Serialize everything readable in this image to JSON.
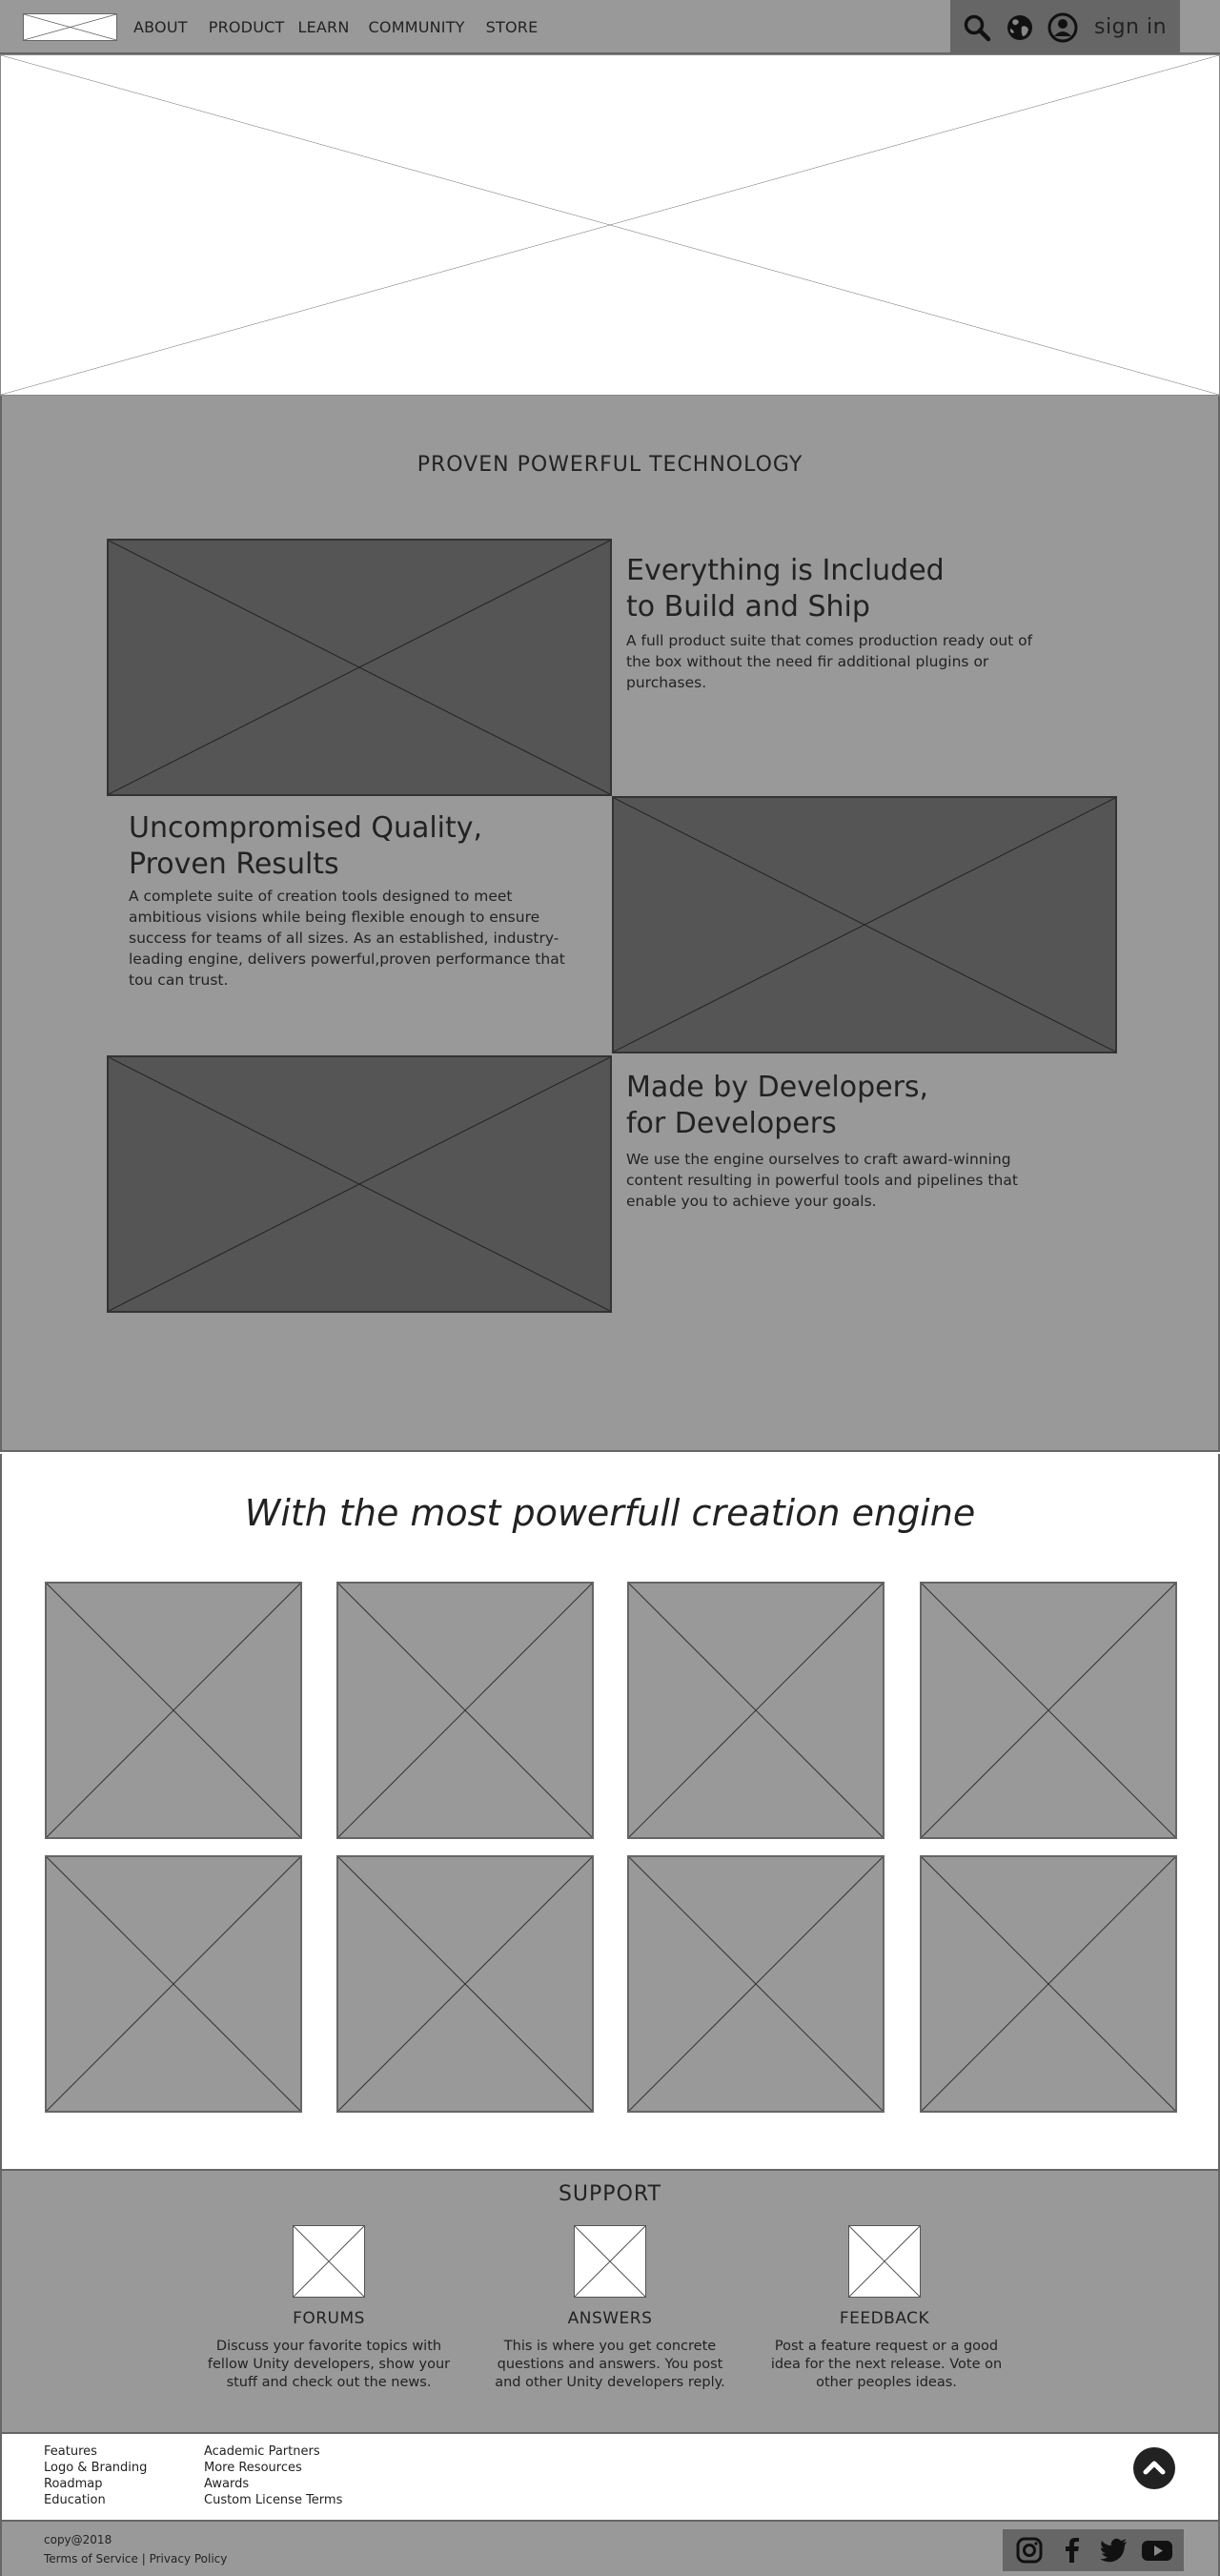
{
  "nav": {
    "logo_alt": "",
    "items": [
      "ABOUT",
      "PRODUCT",
      "LEARN",
      "COMMUNITY",
      "STORE"
    ],
    "sign_in": "sign in",
    "icons": [
      "search-icon",
      "globe-icon",
      "user-icon"
    ]
  },
  "tech": {
    "title": "PROVEN POWERFUL TECHNOLOGY",
    "features": [
      {
        "heading_line1": "Everything is Included",
        "heading_line2": "to Build and Ship",
        "body": "A full product suite that comes production ready out of the box without the need fir additional plugins or purchases."
      },
      {
        "heading_line1": "Uncompromised Quality,",
        "heading_line2": "Proven Results",
        "body": "A complete suite of creation tools designed to meet ambitious visions while being flexible enough to ensure success for teams of all sizes. As an established, industry-leading engine, delivers powerful,proven performance that tou can trust."
      },
      {
        "heading_line1": "Made by Developers,",
        "heading_line2": "for Developers",
        "body": "We use the engine ourselves to craft award-winning content resulting in powerful tools and pipelines that enable you to achieve your goals."
      }
    ]
  },
  "engine": {
    "title": "With the most powerfull creation engine"
  },
  "support": {
    "title": "SUPPORT",
    "items": [
      {
        "heading": "FORUMS",
        "body": "Discuss your favorite topics with fellow Unity developers, show your stuff and check out the news."
      },
      {
        "heading": "ANSWERS",
        "body": "This is where you get concrete questions and answers. You post and other Unity developers reply."
      },
      {
        "heading": "FEEDBACK",
        "body": "Post a feature request or a good idea for the next release. Vote on other peoples ideas."
      }
    ]
  },
  "footer": {
    "col1": [
      "Features",
      "Logo & Branding",
      "Roadmap",
      "Education"
    ],
    "col2": [
      "Academic Partners",
      "More Resources",
      "Awards",
      "Custom License Terms"
    ],
    "copyright": "copy@2018",
    "terms": "Terms of Service",
    "separator": "|",
    "privacy": "Privacy Policy",
    "social_icons": [
      "instagram-icon",
      "facebook-icon",
      "twitter-icon",
      "youtube-icon"
    ]
  }
}
